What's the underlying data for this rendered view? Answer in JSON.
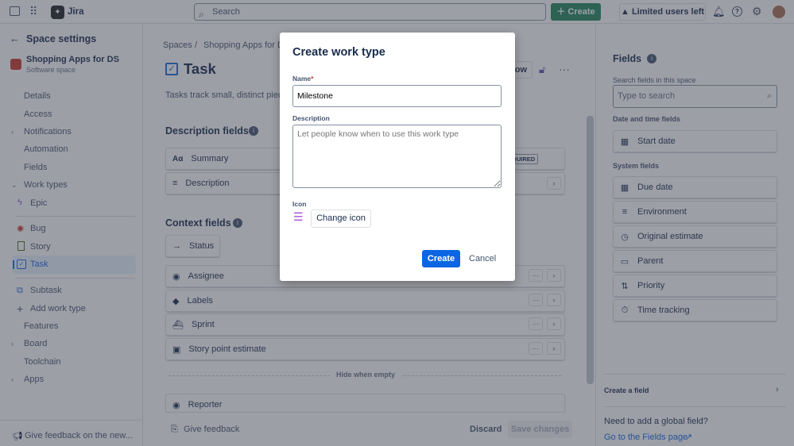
{
  "topbar": {
    "app_name": "Jira",
    "search_placeholder": "Search",
    "create_label": "Create",
    "limited_label": "Limited users left"
  },
  "sidebar": {
    "title": "Space settings",
    "space_name": "Shopping Apps for DS",
    "space_type": "Software space",
    "items": [
      "Details",
      "Access",
      "Notifications",
      "Automation",
      "Fields",
      "Work types"
    ],
    "work_types": [
      "Epic",
      "Bug",
      "Story",
      "Task",
      "Subtask"
    ],
    "add_work_type": "Add work type",
    "more": [
      "Features",
      "Board",
      "Toolchain",
      "Apps"
    ],
    "feedback": "Give feedback on the new..."
  },
  "main": {
    "breadcrumb": [
      "Spaces",
      "Shopping Apps for D"
    ],
    "title": "Task",
    "description": "Tasks track small, distinct piece",
    "header_btn_partial": "ow",
    "desc_fields_title": "Description fields",
    "required_partial": "QUIRED",
    "desc_fields": [
      "Summary",
      "Description"
    ],
    "context_title": "Context fields",
    "status": "Status",
    "context_fields": [
      "Assignee",
      "Labels",
      "Sprint",
      "Story point estimate"
    ],
    "hide_when_empty": "Hide when empty",
    "reporter": "Reporter",
    "give_feedback": "Give feedback",
    "discard": "Discard",
    "save": "Save changes"
  },
  "right": {
    "title": "Fields",
    "search_label": "Search fields in this space",
    "search_placeholder": "Type to search",
    "date_section": "Date and time fields",
    "date_fields": [
      "Start date"
    ],
    "system_section": "System fields",
    "system_fields": [
      "Due date",
      "Environment",
      "Original estimate",
      "Parent",
      "Priority",
      "Time tracking"
    ],
    "create_field": "Create a field",
    "global_q": "Need to add a global field?",
    "go_link": "Go to the Fields page"
  },
  "modal": {
    "title": "Create work type",
    "name_label": "Name",
    "required_mark": "*",
    "name_value": "Milestone",
    "desc_label": "Description",
    "desc_placeholder": "Let people know when to use this work type",
    "icon_label": "Icon",
    "change_icon": "Change icon",
    "create": "Create",
    "cancel": "Cancel"
  }
}
